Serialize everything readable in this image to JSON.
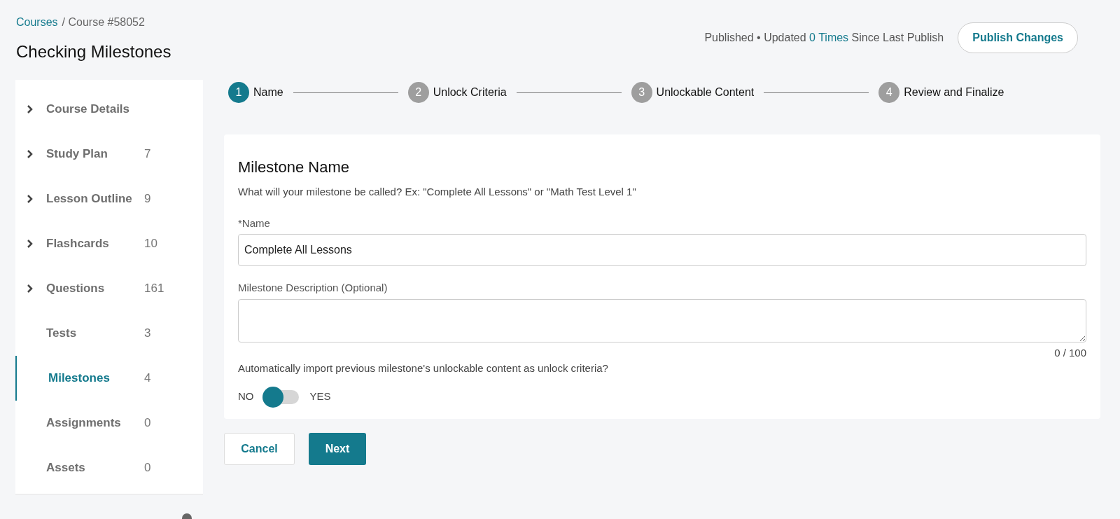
{
  "breadcrumb": {
    "link": "Courses",
    "current": "/ Course #58052"
  },
  "title": "Checking Milestones",
  "status": {
    "prefix": "Published • Updated",
    "count": "0 Times",
    "suffix": "Since Last Publish"
  },
  "publish_button": "Publish Changes",
  "sidebar": {
    "items": [
      {
        "label": "Course Details",
        "expandable": true,
        "selected": false
      },
      {
        "label": "Study Plan",
        "count": "7",
        "expandable": true,
        "selected": false
      },
      {
        "label": "Lesson Outline",
        "count": "9",
        "expandable": true,
        "selected": false
      },
      {
        "label": "Flashcards",
        "count": "10",
        "expandable": true,
        "selected": false
      },
      {
        "label": "Questions",
        "count": "161",
        "expandable": true,
        "selected": false
      },
      {
        "label": "Tests",
        "count": "3",
        "expandable": false,
        "selected": false
      },
      {
        "label": "Milestones",
        "count": "4",
        "expandable": false,
        "selected": true
      },
      {
        "label": "Assignments",
        "count": "0",
        "expandable": false,
        "selected": false
      },
      {
        "label": "Assets",
        "count": "0",
        "expandable": false,
        "selected": false
      }
    ]
  },
  "steps": [
    {
      "number": "1",
      "label": "Name",
      "selected": true
    },
    {
      "number": "2",
      "label": "Unlock Criteria",
      "selected": false
    },
    {
      "number": "3",
      "label": "Unlockable Content",
      "selected": false
    },
    {
      "number": "4",
      "label": "Review and Finalize",
      "selected": false
    }
  ],
  "form": {
    "heading": "Milestone Name",
    "hint": "What will your milestone be called? Ex: \"Complete All Lessons\" or \"Math Test Level 1\"",
    "name_label": "*Name",
    "name_value": "Complete All Lessons",
    "description_label": "Milestone Description (Optional)",
    "char_count": "0 / 100",
    "import_question": "Automatically import previous milestone's unlockable content as unlock criteria?",
    "toggle": {
      "off_label": "NO",
      "on_label": "YES",
      "on": false
    }
  },
  "buttons": {
    "cancel": "Cancel",
    "next": "Next"
  }
}
